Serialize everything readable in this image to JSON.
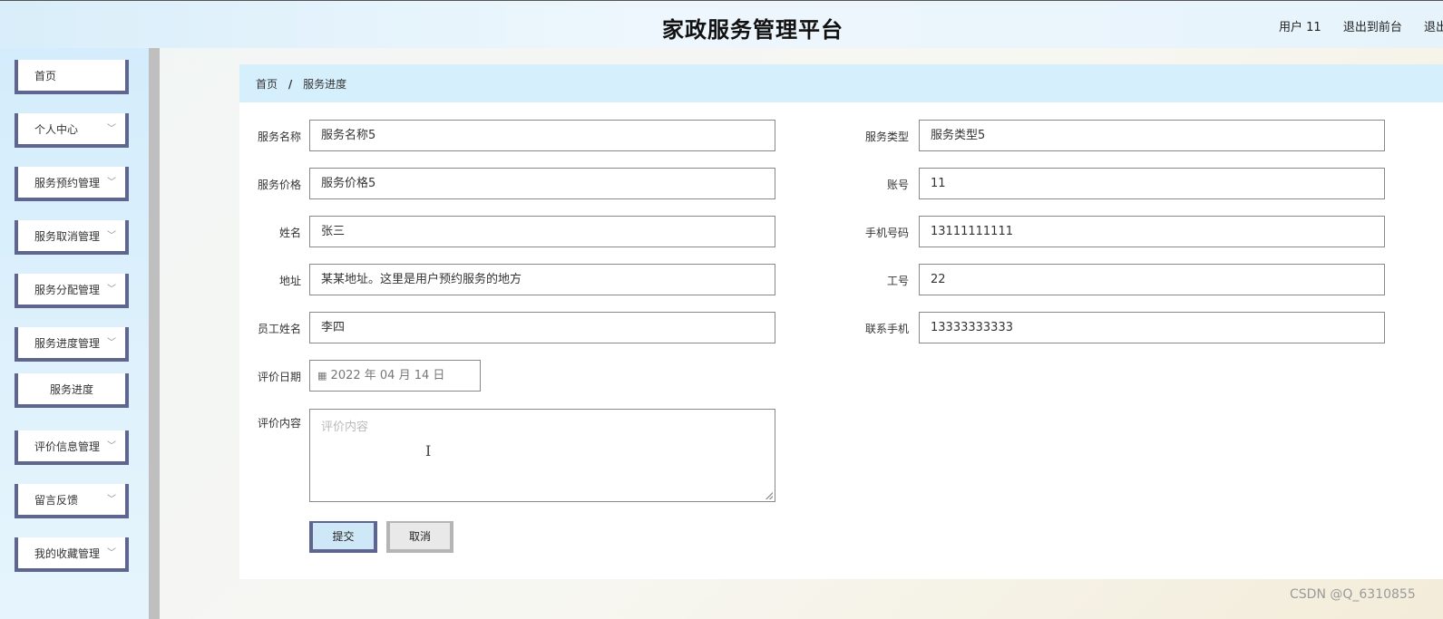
{
  "header": {
    "title": "家政服务管理平台",
    "user": "用户 11",
    "exit_front": "退出到前台",
    "exit": "退出"
  },
  "sidebar": {
    "items": [
      {
        "label": "首页"
      },
      {
        "label": "个人中心"
      },
      {
        "label": "服务预约管理"
      },
      {
        "label": "服务取消管理"
      },
      {
        "label": "服务分配管理"
      },
      {
        "label": "服务进度管理"
      },
      {
        "label": "服务进度"
      },
      {
        "label": "评价信息管理"
      },
      {
        "label": "留言反馈"
      },
      {
        "label": "我的收藏管理"
      }
    ],
    "chevron": "chevron-down-icon"
  },
  "breadcrumb": {
    "home": "首页",
    "separator": "/",
    "current": "服务进度"
  },
  "form": {
    "service_name": {
      "label": "服务名称",
      "value": "服务名称5"
    },
    "service_type": {
      "label": "服务类型",
      "value": "服务类型5"
    },
    "service_price": {
      "label": "服务价格",
      "value": "服务价格5"
    },
    "account": {
      "label": "账号",
      "value": "11"
    },
    "name": {
      "label": "姓名",
      "value": "张三"
    },
    "phone": {
      "label": "手机号码",
      "value": "13111111111"
    },
    "address": {
      "label": "地址",
      "value": "某某地址。这里是用户预约服务的地方"
    },
    "employee_no": {
      "label": "工号",
      "value": "22"
    },
    "employee_name": {
      "label": "员工姓名",
      "value": "李四"
    },
    "contact_phone": {
      "label": "联系手机",
      "value": "13333333333"
    },
    "review_date": {
      "label": "评价日期",
      "value": "2022 年 04 月 14 日"
    },
    "review_content": {
      "label": "评价内容",
      "placeholder": "评价内容"
    }
  },
  "buttons": {
    "submit": "提交",
    "cancel": "取消"
  },
  "watermark": "CSDN @Q_6310855",
  "colors": {
    "accent_border": "#5e6690",
    "breadcrumb_bg": "#d6effc"
  }
}
